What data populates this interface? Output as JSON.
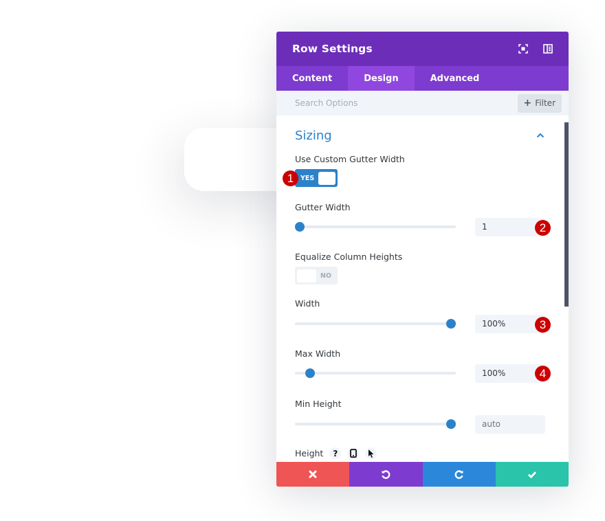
{
  "modal": {
    "title": "Row Settings",
    "header_icons": [
      "fullscreen-icon",
      "split-view-icon"
    ],
    "tabs": [
      {
        "label": "Content",
        "active": false
      },
      {
        "label": "Design",
        "active": true
      },
      {
        "label": "Advanced",
        "active": false
      }
    ],
    "search": {
      "placeholder": "Search Options",
      "value": ""
    },
    "filter_label": "Filter",
    "section": {
      "title": "Sizing",
      "expanded": true
    },
    "fields": {
      "custom_gutter": {
        "label": "Use Custom Gutter Width",
        "state": "YES",
        "on": true,
        "annotation": "1"
      },
      "gutter_width": {
        "label": "Gutter Width",
        "value": "1",
        "slider_fraction": 0.0,
        "annotation": "2"
      },
      "equalize": {
        "label": "Equalize Column Heights",
        "state": "NO",
        "on": false
      },
      "width": {
        "label": "Width",
        "value": "100%",
        "slider_fraction": 1.0,
        "annotation": "3"
      },
      "max_width": {
        "label": "Max Width",
        "value": "100%",
        "slider_fraction": 0.07,
        "annotation": "4"
      },
      "min_height": {
        "label": "Min Height",
        "value": "",
        "placeholder": "auto",
        "slider_fraction": 1.0
      },
      "height": {
        "label": "Height",
        "icons": [
          "help-icon",
          "mobile-icon",
          "hover-cursor-icon"
        ],
        "help_glyph": "?"
      }
    },
    "footer": [
      "cancel",
      "undo",
      "redo",
      "save"
    ]
  },
  "colors": {
    "header": "#6c2eb9",
    "tabs": "#7d3bcf",
    "active_tab": "#8f47e0",
    "accent_blue": "#2c82c9",
    "cancel": "#ef5555",
    "undo": "#7e3bd0",
    "redo": "#2b87da",
    "save": "#29c4a9",
    "annotation": "#cc0000"
  }
}
